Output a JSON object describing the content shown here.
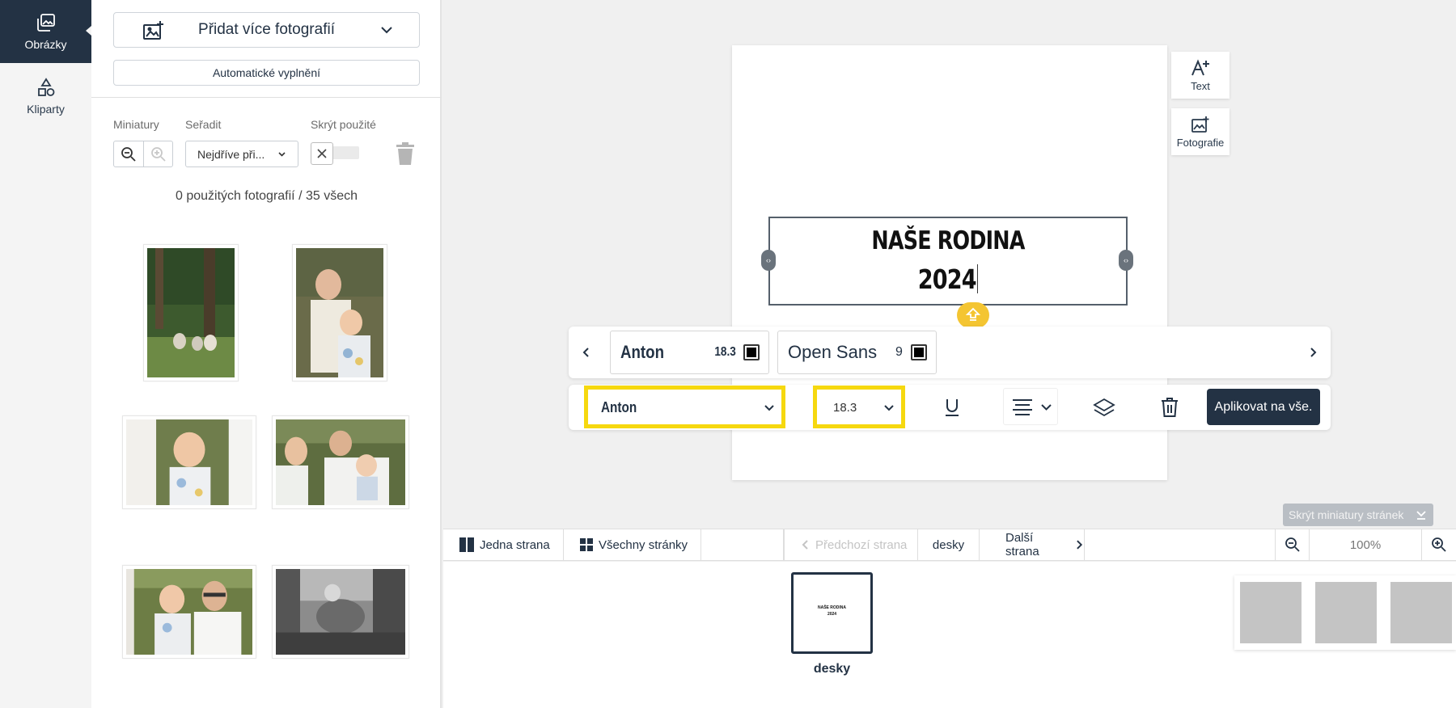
{
  "rail": {
    "items": [
      {
        "label": "Obrázky",
        "icon": "images-icon",
        "active": true
      },
      {
        "label": "Kliparty",
        "icon": "shapes-icon",
        "active": false
      }
    ]
  },
  "panel": {
    "add_photos_label": "Přidat více fotografií",
    "autofill_label": "Automatické vyplnění",
    "thumbs_label": "Miniatury",
    "sort_label": "Seřadit",
    "sort_value": "Nejdříve při...",
    "hide_used_label": "Skrýt použité",
    "count_text": "0 použitých fotografií / 35 všech"
  },
  "canvas": {
    "text_line1": "NAŠE RODINA",
    "text_line2": "2024",
    "side_tools": [
      {
        "label": "Text",
        "icon": "add-text-icon"
      },
      {
        "label": "Fotografie",
        "icon": "add-photo-icon"
      }
    ]
  },
  "text_styles": [
    {
      "font": "Anton",
      "size": "18.3",
      "color": "#000000"
    },
    {
      "font": "Open Sans",
      "size": "9",
      "color": "#000000"
    }
  ],
  "editor": {
    "font_value": "Anton",
    "size_value": "18.3",
    "apply_label": "Aplikovat na vše."
  },
  "hide_thumbs_label": "Skrýt miniatury stránek",
  "navbar": {
    "single_page": "Jedna strana",
    "all_pages": "Všechny stránky",
    "prev_page": "Předchozí strana",
    "current_page": "desky",
    "next_page": "Další strana",
    "zoom": "100%"
  },
  "strip": {
    "page_label": "desky",
    "thumb_line1": "NAŠE RODINA",
    "thumb_line2": "2024"
  },
  "colors": {
    "brand_dark": "#233244",
    "highlight_yellow": "#f6d80f",
    "rotate_handle": "#f4c532"
  }
}
